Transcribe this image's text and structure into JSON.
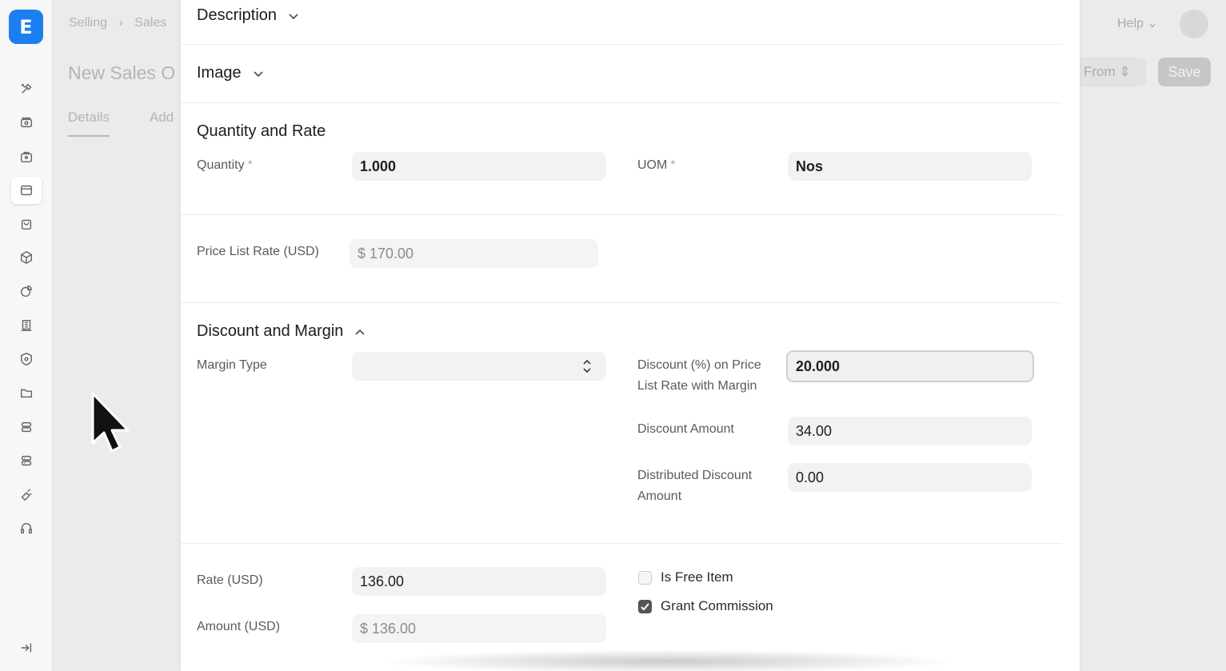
{
  "app": {
    "logo_letter": "E"
  },
  "sidebar": {
    "icons": [
      "tools-icon",
      "cash-register-icon",
      "briefcase-icon",
      "card-icon",
      "shopping-bag-icon",
      "package-icon",
      "chart-pie-icon",
      "building-icon",
      "shield-icon",
      "folder-icon",
      "database-icon",
      "database-alt-icon",
      "megaphone-icon",
      "headset-icon"
    ],
    "collapse_icon": "expand-sidebar-icon"
  },
  "background": {
    "breadcrumb": [
      "Selling",
      "Sales"
    ],
    "title": "New Sales O",
    "tabs": [
      "Details",
      "Add"
    ],
    "help_label": "Help",
    "from_label": "From",
    "save_label": "Save"
  },
  "panel": {
    "sections": {
      "description": "Description",
      "image": "Image",
      "quantity_rate": "Quantity and Rate",
      "discount_margin": "Discount and Margin"
    },
    "quantity": {
      "label": "Quantity",
      "required": "*",
      "value": "1.000"
    },
    "uom": {
      "label": "UOM",
      "required": "*",
      "value": "Nos"
    },
    "price_list_rate": {
      "label": "Price List Rate (USD)",
      "value": "$ 170.00"
    },
    "margin_type": {
      "label": "Margin Type",
      "value": ""
    },
    "discount_pct": {
      "label_line1": "Discount (%) on Price",
      "label_line2": "List Rate with Margin",
      "value": "20.000"
    },
    "discount_amount": {
      "label": "Discount Amount",
      "value": "34.00"
    },
    "distributed_discount": {
      "label_line1": "Distributed Discount",
      "label_line2": "Amount",
      "value": "0.00"
    },
    "rate": {
      "label": "Rate (USD)",
      "value": "136.00"
    },
    "amount": {
      "label": "Amount (USD)",
      "value": "$ 136.00"
    },
    "is_free_item": {
      "label": "Is Free Item",
      "checked": false
    },
    "grant_commission": {
      "label": "Grant Commission",
      "checked": true
    }
  }
}
